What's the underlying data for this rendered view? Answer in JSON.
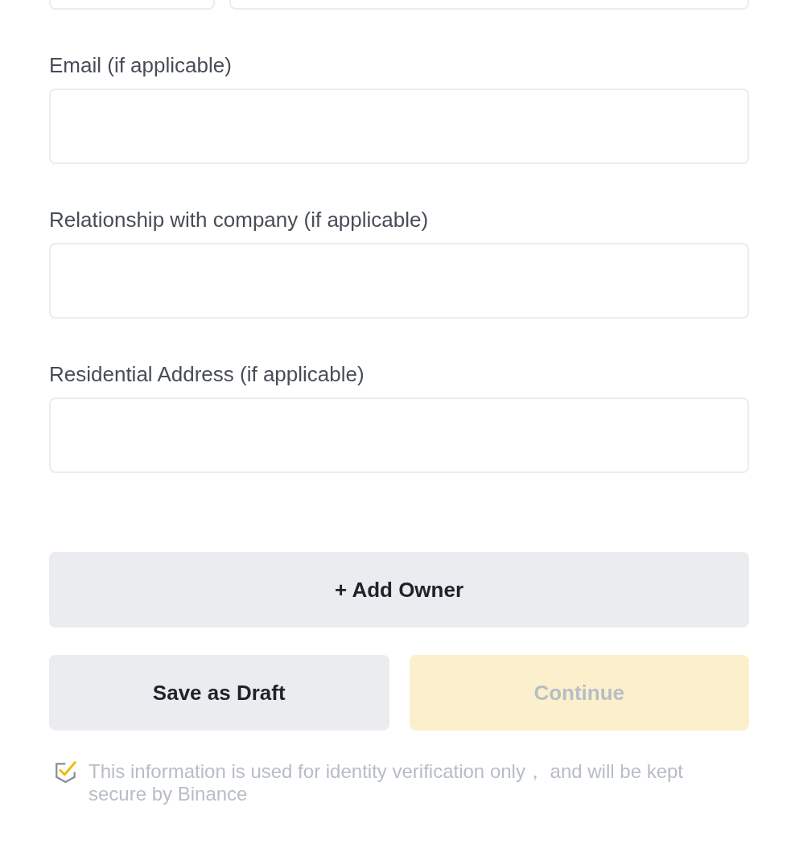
{
  "fields": [
    {
      "label": "Email (if applicable)"
    },
    {
      "label": "Relationship with company (if applicable)"
    },
    {
      "label": "Residential Address (if applicable)"
    }
  ],
  "add_owner_button": {
    "label": "+ Add Owner"
  },
  "actions": [
    {
      "kind": "secondary",
      "label": "Save as Draft",
      "disabled": false
    },
    {
      "kind": "primary",
      "label": "Continue",
      "disabled": true
    }
  ],
  "notice": {
    "text": "This information is used for identity verification only， and will be kept secure by Binance"
  }
}
